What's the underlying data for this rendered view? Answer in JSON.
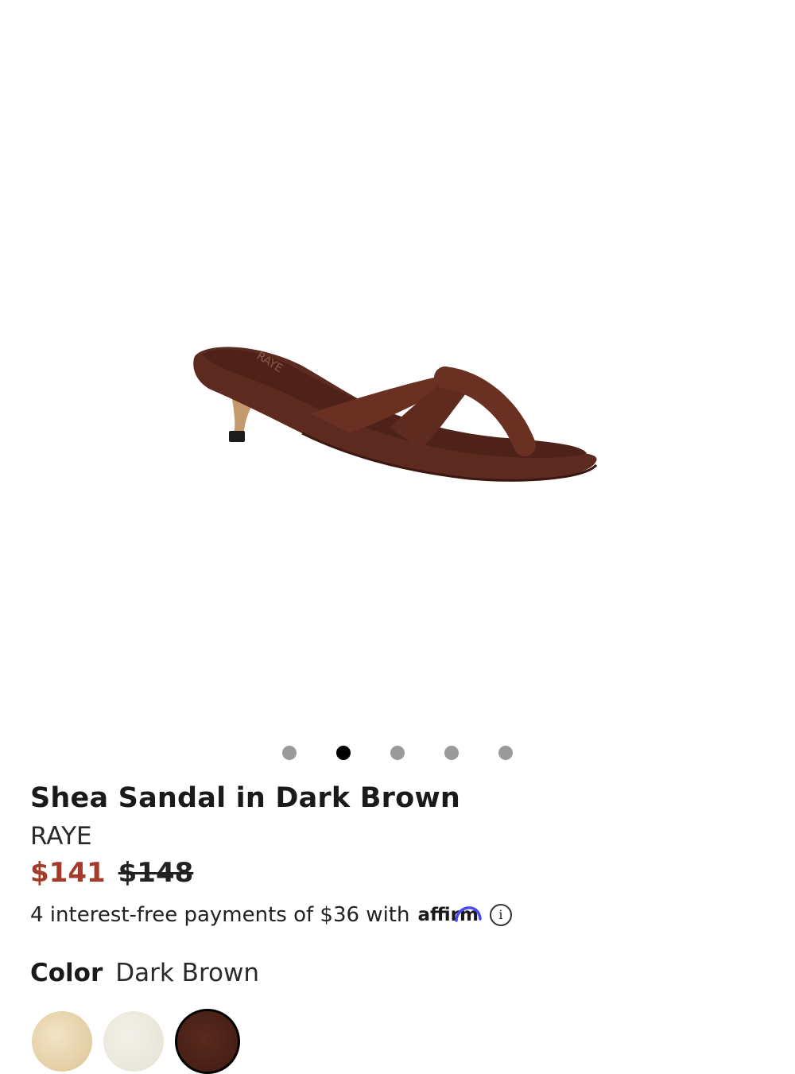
{
  "product": {
    "title": "Shea Sandal in Dark Brown",
    "brand": "RAYE",
    "insole_brand": "RAYE",
    "price_sale": "$141",
    "price_original": "$148",
    "affirm_text": "4 interest-free payments of $36 with",
    "affirm_logo": "affirm",
    "info_icon": "i",
    "color_label": "Color",
    "color_value": "Dark Brown"
  },
  "carousel": {
    "total": 5,
    "active_index": 1
  },
  "swatches": [
    {
      "name": "natural",
      "color": "#e6d2a9",
      "selected": false
    },
    {
      "name": "cream",
      "color": "#e9e6da",
      "selected": false
    },
    {
      "name": "dark-brown",
      "color": "#4a2117",
      "selected": true
    }
  ],
  "colors": {
    "sale_price": "#a33a2a",
    "sandal": "#5a281d"
  }
}
